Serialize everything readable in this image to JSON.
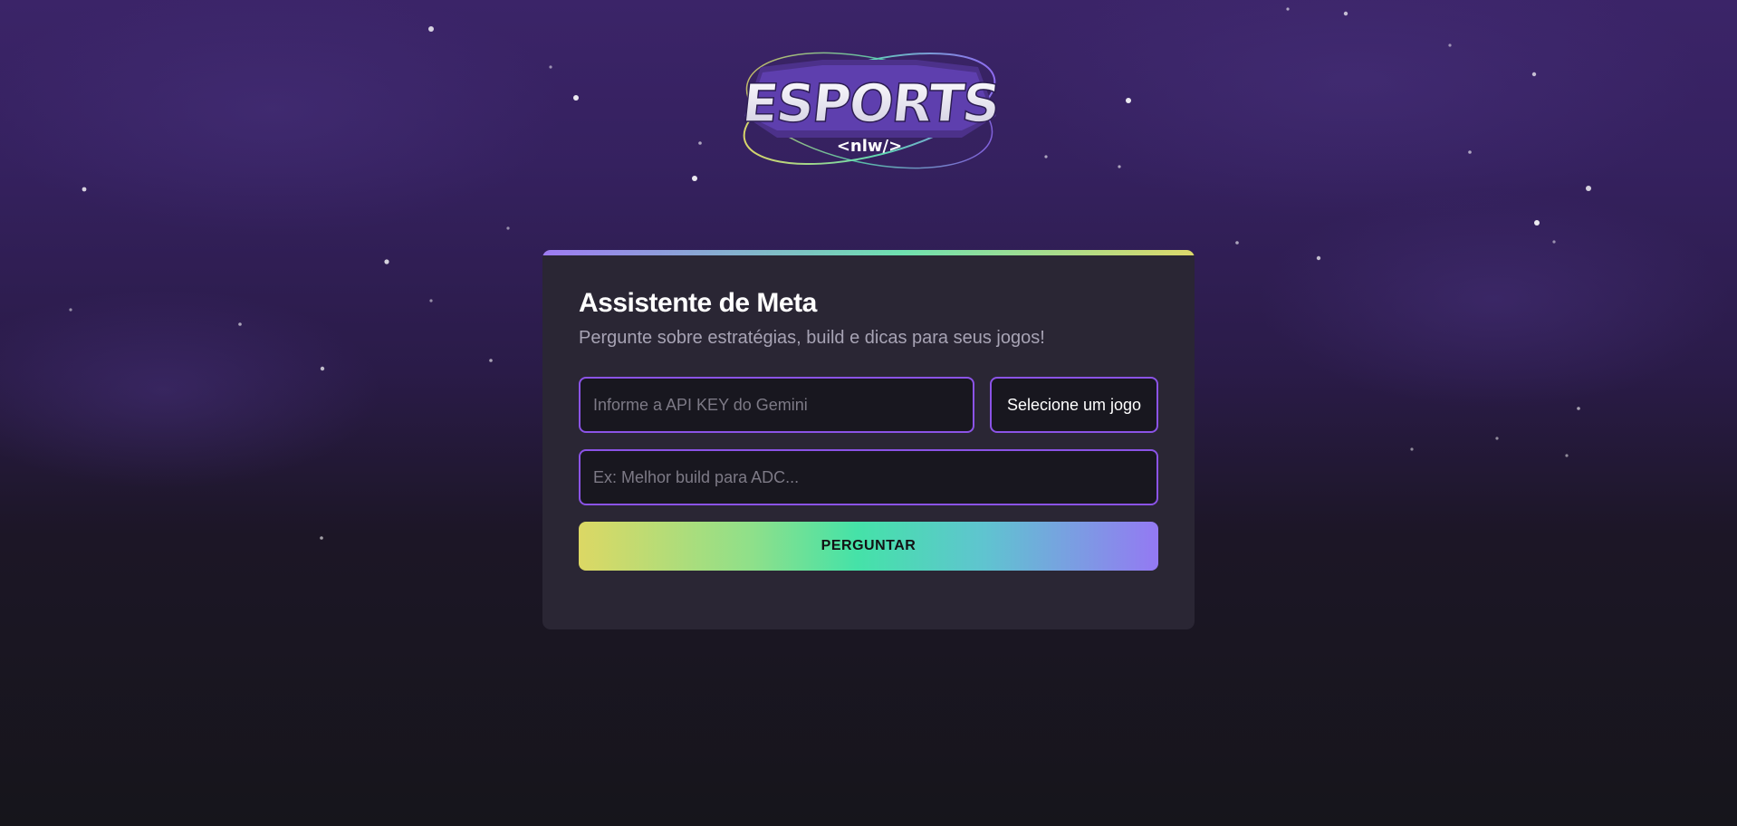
{
  "logo": {
    "brand": "ESPORTS",
    "tag": "<nlw/>"
  },
  "assistant": {
    "title": "Assistente de Meta",
    "subtitle": "Pergunte sobre estratégias, build e dicas para seus jogos!",
    "api_key_placeholder": "Informe a API KEY do Gemini",
    "game_select_label": "Selecione um jogo",
    "question_placeholder": "Ex: Melhor build para ADC...",
    "submit_label": "PERGUNTAR"
  },
  "colors": {
    "accent_border": "#8b53e6",
    "card_background": "#2a2634",
    "gradient_start": "#dcd864",
    "gradient_mid": "#45e2a8",
    "gradient_end": "#9479f3"
  },
  "icons": {
    "background": "starfield"
  }
}
